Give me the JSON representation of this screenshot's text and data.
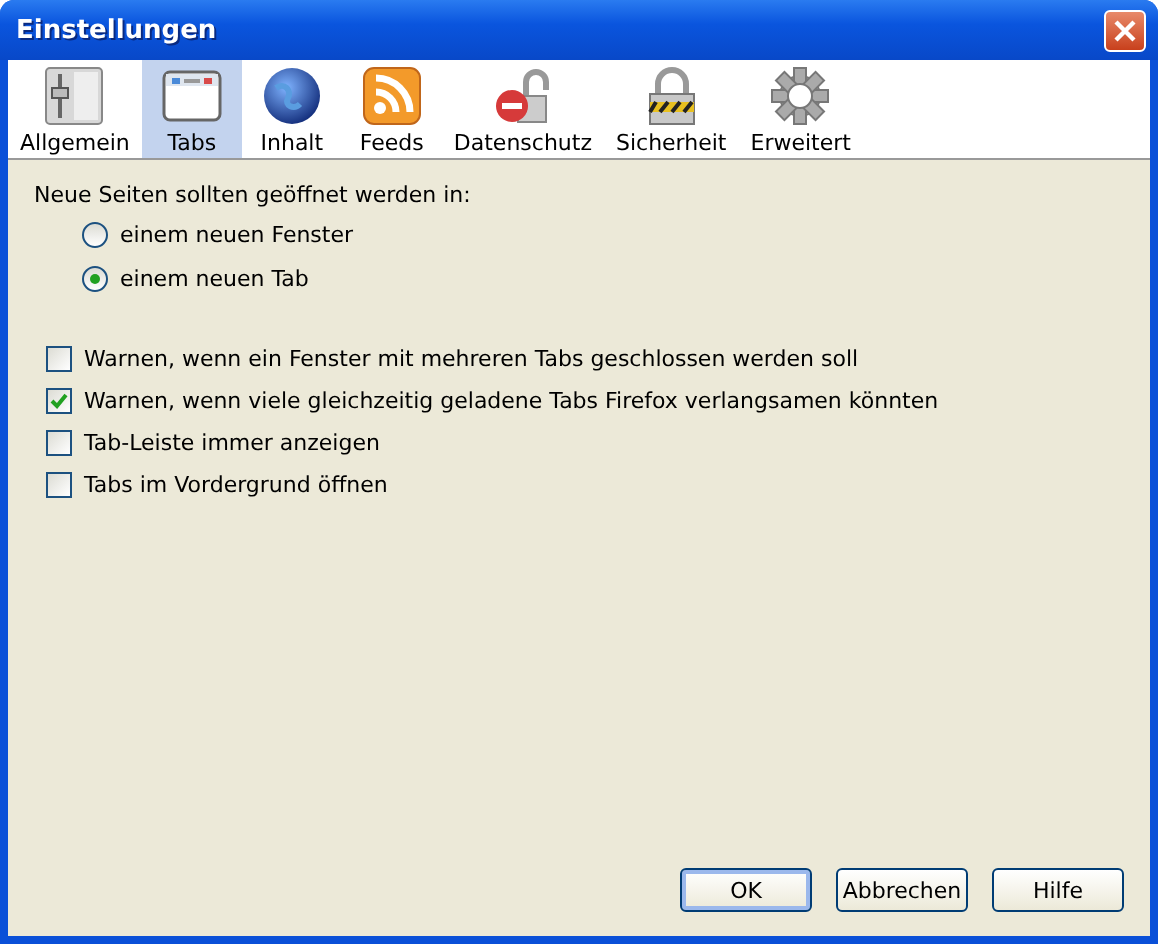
{
  "window": {
    "title": "Einstellungen"
  },
  "panes": [
    {
      "label": "Allgemein",
      "selected": false
    },
    {
      "label": "Tabs",
      "selected": true
    },
    {
      "label": "Inhalt",
      "selected": false
    },
    {
      "label": "Feeds",
      "selected": false
    },
    {
      "label": "Datenschutz",
      "selected": false
    },
    {
      "label": "Sicherheit",
      "selected": false
    },
    {
      "label": "Erweitert",
      "selected": false
    }
  ],
  "open_in": {
    "label": "Neue Seiten sollten geöffnet werden in:",
    "options": [
      {
        "label": "einem neuen Fenster",
        "selected": false
      },
      {
        "label": "einem neuen Tab",
        "selected": true
      }
    ]
  },
  "checkboxes": [
    {
      "label": "Warnen, wenn ein Fenster mit mehreren Tabs geschlossen werden soll",
      "checked": false
    },
    {
      "label": "Warnen, wenn viele gleichzeitig geladene Tabs Firefox verlangsamen könnten",
      "checked": true
    },
    {
      "label": "Tab-Leiste immer anzeigen",
      "checked": false
    },
    {
      "label": "Tabs im Vordergrund öffnen",
      "checked": false
    }
  ],
  "buttons": [
    {
      "label": "OK",
      "default": true
    },
    {
      "label": "Abbrechen",
      "default": false
    },
    {
      "label": "Hilfe",
      "default": false
    }
  ]
}
